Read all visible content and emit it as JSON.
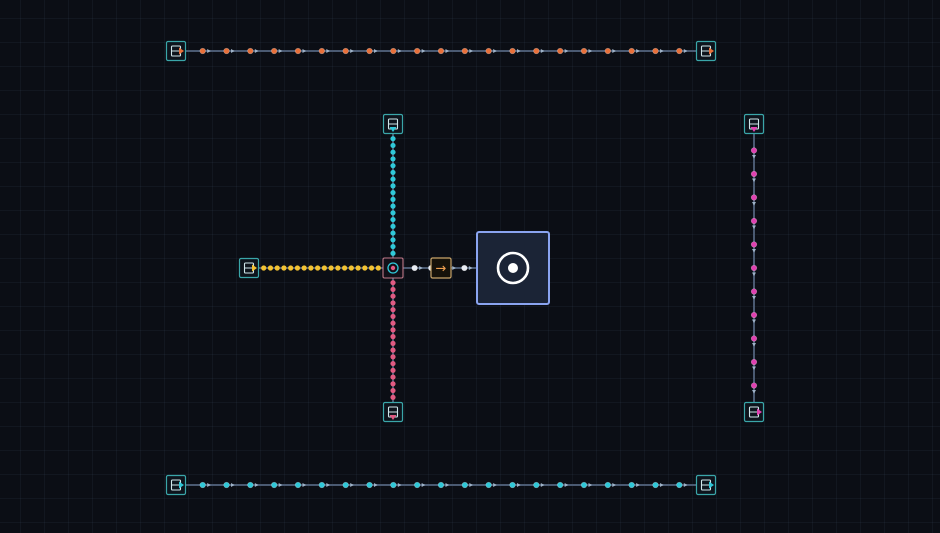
{
  "colors": {
    "background": "#0b0e15",
    "grid": "#1a2230",
    "node_border": "#3aa6a9",
    "belt": "#4a5a72",
    "arrow": "#9fb3c8",
    "core_border": "#8aa4f0",
    "core_fill": "#1b2436",
    "core_icon": "#ffffff",
    "router_border": "#c9a56a",
    "flow_orange": "#e8703a",
    "flow_cyan": "#2fc8d8",
    "flow_yellow": "#f2c232",
    "flow_pink": "#e05a82",
    "flow_magenta": "#e040b0",
    "flow_white": "#e8ecf2"
  },
  "game": {
    "nodes": [
      {
        "name": "node-source-top-left",
        "role": "source",
        "dir": "right",
        "color": "#e8703a"
      },
      {
        "name": "node-sink-top-right",
        "role": "sink",
        "dir": "right",
        "color": "#e8703a"
      },
      {
        "name": "node-source-bottom-left",
        "role": "source",
        "dir": "right",
        "color": "#2fc8d8"
      },
      {
        "name": "node-sink-bottom-right",
        "role": "sink",
        "dir": "right",
        "color": "#2fc8d8"
      },
      {
        "name": "node-source-center-top",
        "role": "source",
        "dir": "down",
        "color": "#2fc8d8"
      },
      {
        "name": "node-source-center-left",
        "role": "source",
        "dir": "right",
        "color": "#f2c232"
      },
      {
        "name": "node-sink-center-bottom",
        "role": "sink",
        "dir": "down",
        "color": "#e05a82"
      },
      {
        "name": "node-source-right-top",
        "role": "source",
        "dir": "down",
        "color": "#e040b0"
      },
      {
        "name": "node-sink-right-bottom",
        "role": "sink",
        "dir": "right",
        "color": "#e040b0"
      }
    ],
    "belts": [
      {
        "name": "belt-top",
        "color": "#e8703a",
        "dense": false
      },
      {
        "name": "belt-bottom",
        "color": "#2fc8d8",
        "dense": false
      },
      {
        "name": "belt-center-vertical-upper",
        "color": "#2fc8d8",
        "dense": true
      },
      {
        "name": "belt-center-horizontal-left",
        "color": "#f2c232",
        "dense": true
      },
      {
        "name": "belt-center-vertical-lower",
        "color": "#e05a82",
        "dense": true
      },
      {
        "name": "belt-right-vertical",
        "color": "#e040b0",
        "dense": false
      },
      {
        "name": "belt-to-core",
        "color": "#e8ecf2",
        "dense": false
      }
    ],
    "junction": {
      "name": "junction-merge",
      "symbol": "◎"
    },
    "router": {
      "name": "router-arrow",
      "symbol": "→"
    },
    "core": {
      "name": "core-target",
      "icon": "target-icon"
    }
  }
}
